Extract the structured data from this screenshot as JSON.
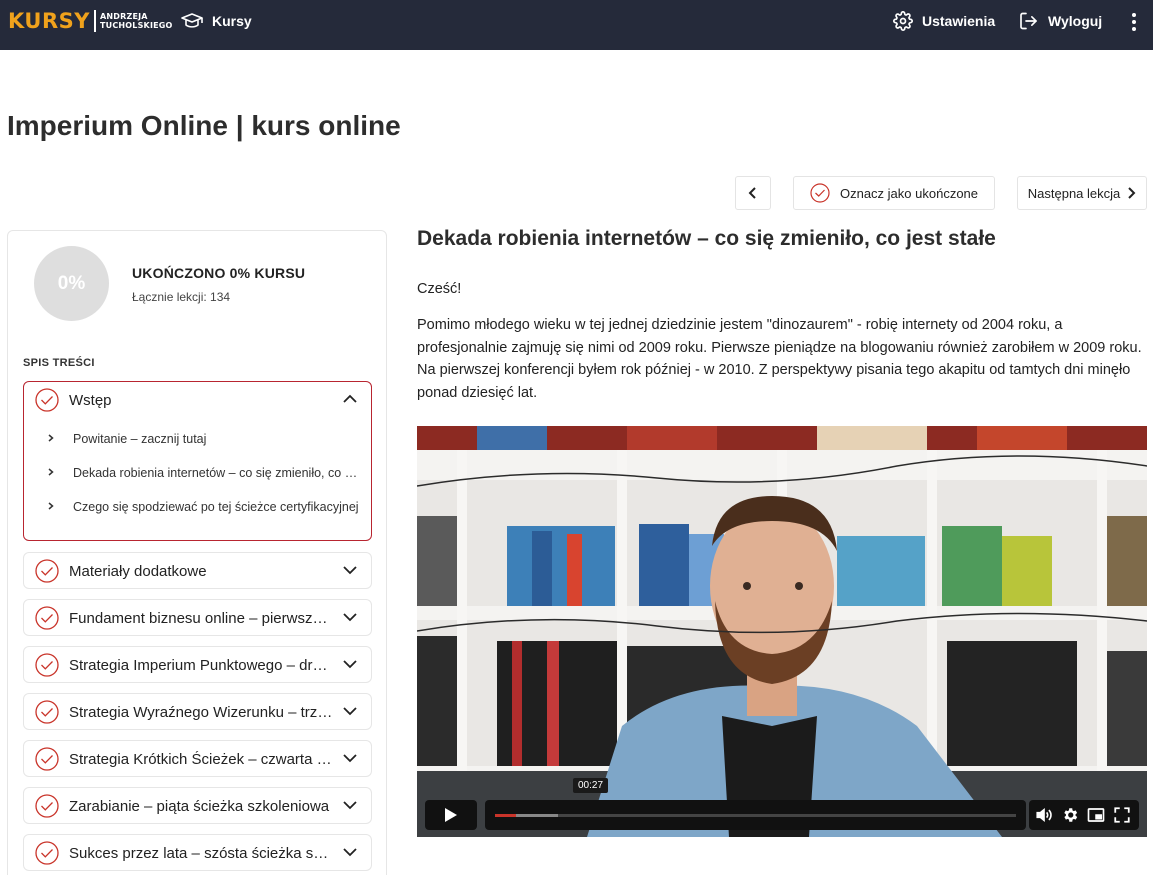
{
  "header": {
    "logo_main": "KURSY",
    "logo_sub_1": "ANDRZEJA",
    "logo_sub_2": "TUCHOLSKIEGO",
    "nav_courses": "Kursy",
    "settings": "Ustawienia",
    "logout": "Wyloguj"
  },
  "page": {
    "title": "Imperium Online | kurs online"
  },
  "lesson_nav": {
    "mark_complete": "Oznacz jako ukończone",
    "next_lesson": "Następna lekcja"
  },
  "sidebar": {
    "progress_percent": "0%",
    "progress_title": "UKOŃCZONO 0% KURSU",
    "total_lessons": "Łącznie lekcji: 134",
    "toc_header": "SPIS TREŚCI",
    "sections": [
      {
        "label": "Wstęp",
        "lessons": [
          "Powitanie – zacznij tutaj",
          "Dekada robienia internetów – co się zmieniło, co jest stałe",
          "Czego się spodziewać po tej ścieżce certyfikacyjnej"
        ]
      },
      {
        "label": "Materiały dodatkowe"
      },
      {
        "label": "Fundament biznesu online – pierwsza ścieżka szkoleniowa"
      },
      {
        "label": "Strategia Imperium Punktowego – druga ścieżka szkoleniowa"
      },
      {
        "label": "Strategia Wyraźnego Wizerunku – trzecia ścieżka szkoleniowa"
      },
      {
        "label": "Strategia Krótkich Ścieżek – czwarta ścieżka szkoleniowa"
      },
      {
        "label": "Zarabianie – piąta ścieżka szkoleniowa"
      },
      {
        "label": "Sukces przez lata – szósta ścieżka szkoleniowa"
      }
    ]
  },
  "content": {
    "lesson_title": "Dekada robienia internetów – co się zmieniło, co jest stałe",
    "greeting": "Cześć!",
    "paragraph": "Pomimo młodego wieku w tej jednej dziedzinie jestem \"dinozaurem\" - robię internety od 2004 roku, a profesjonalnie zajmuję się nimi od 2009 roku. Pierwsze pieniądze na blogowaniu również zarobiłem w 2009 roku. Na pierwszej konferencji byłem rok później - w 2010. Z perspektywy pisania tego akapitu od tamtych dni minęło ponad dziesięć lat."
  },
  "video": {
    "time_tooltip": "00:27",
    "played_fraction": 0.04,
    "buffered_fraction": 0.12
  },
  "colors": {
    "topbar": "#252a3a",
    "logo_accent": "#f0a21c",
    "brand_red": "#b82530",
    "progress_played": "#c9342a"
  }
}
